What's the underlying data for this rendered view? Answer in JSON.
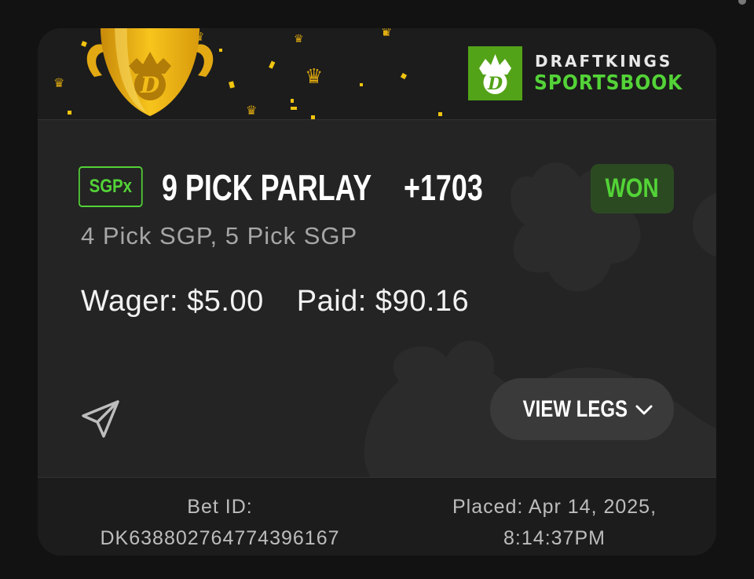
{
  "brand": {
    "line1": "DRAFTKINGS",
    "line2": "SPORTSBOOK",
    "green": "#53d337",
    "logo_green": "#53a318"
  },
  "bet": {
    "tag": "SGPx",
    "title": "9 PICK PARLAY",
    "odds": "+1703",
    "status": "WON",
    "subtitle": "4 Pick SGP, 5 Pick SGP",
    "wager_label": "Wager:",
    "wager_value": "$5.00",
    "paid_label": "Paid:",
    "paid_value": "$90.16"
  },
  "actions": {
    "share_icon": "paper-plane-icon",
    "view_legs_label": "VIEW LEGS",
    "view_legs_icon": "chevron-down-icon"
  },
  "footer": {
    "bet_id_label": "Bet ID:",
    "bet_id_value": "DK638802764774396167",
    "placed_label": "Placed: Apr 14, 2025,",
    "placed_time": "8:14:37PM"
  },
  "icons": {
    "trophy": "trophy-icon",
    "crown_logo": "dk-crown-logo",
    "confetti": "confetti-decoration"
  }
}
